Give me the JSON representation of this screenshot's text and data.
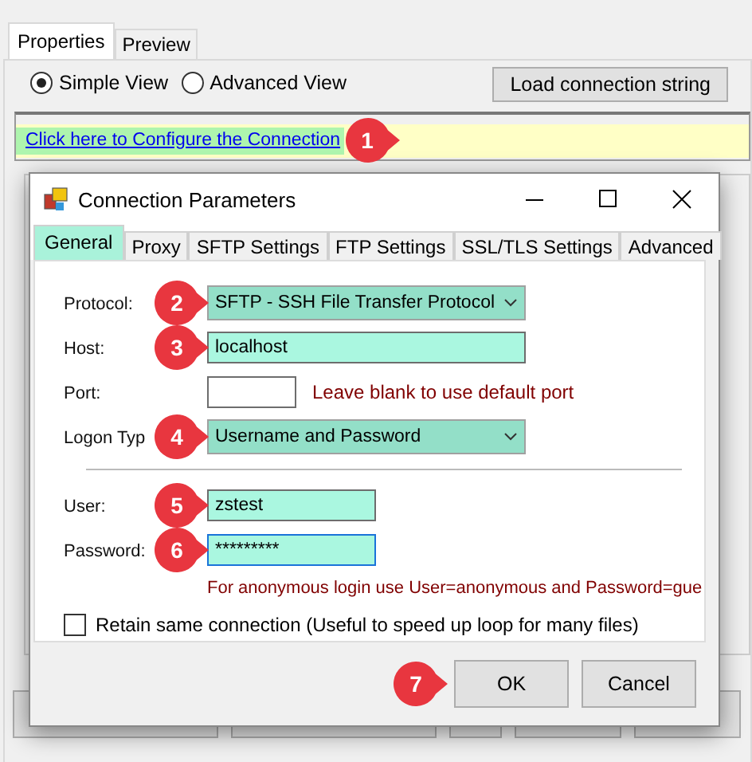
{
  "background": {
    "tabs": [
      {
        "label": "Properties",
        "selected": true
      },
      {
        "label": "Preview",
        "selected": false
      }
    ],
    "view_options": [
      {
        "label": "Simple View",
        "selected": true
      },
      {
        "label": "Advanced View",
        "selected": false
      }
    ],
    "load_button": "Load connection string",
    "link": {
      "text": "Click here to Configure the Connection",
      "callout": "1"
    }
  },
  "dialog": {
    "title": "Connection Parameters",
    "tabs": [
      {
        "label": "General",
        "selected": true
      },
      {
        "label": "Proxy",
        "selected": false
      },
      {
        "label": "SFTP Settings",
        "selected": false
      },
      {
        "label": "FTP Settings",
        "selected": false
      },
      {
        "label": "SSL/TLS Settings",
        "selected": false
      },
      {
        "label": "Advanced",
        "selected": false
      }
    ],
    "fields": [
      {
        "kind": "combo",
        "label": "Protocol:",
        "value": "SFTP - SSH File Transfer Protocol",
        "highlighted": true,
        "focused": false,
        "callout": "2"
      },
      {
        "kind": "text",
        "label": "Host:",
        "value": "localhost",
        "highlighted": true,
        "focused": false,
        "callout": "3"
      },
      {
        "kind": "short",
        "label": "Port:",
        "highlighted": false,
        "focused": false,
        "hint": "Leave blank to use default port"
      },
      {
        "kind": "combo",
        "label": "Logon Typ",
        "value": "Username and Password",
        "highlighted": true,
        "focused": false,
        "callout": "4"
      },
      {
        "kind": "separator"
      },
      {
        "kind": "medium",
        "label": "User:",
        "value": "zstest",
        "highlighted": true,
        "focused": false,
        "callout": "5"
      },
      {
        "kind": "medium",
        "label": "Password:",
        "value": "*********",
        "highlighted": true,
        "focused": true,
        "callout": "6"
      }
    ],
    "note": "For anonymous login use User=anonymous and Password=gue",
    "retain": {
      "label": "Retain same connection (Useful to speed up loop for many files)",
      "checked": false
    },
    "buttons": [
      {
        "label": "OK",
        "callout": "7"
      },
      {
        "label": "Cancel"
      }
    ]
  }
}
